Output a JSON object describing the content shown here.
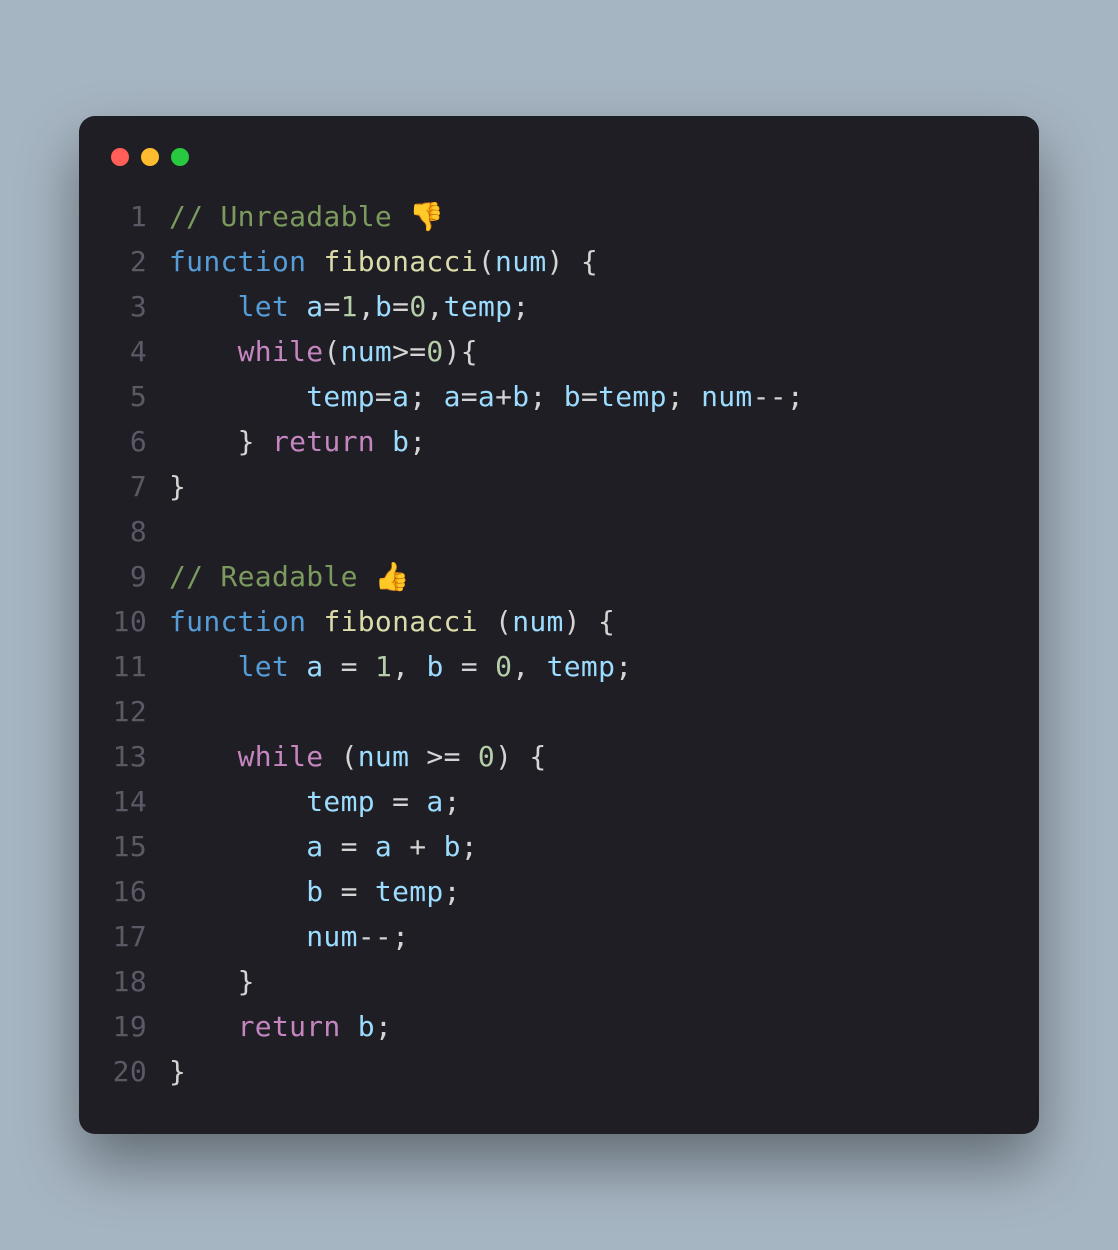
{
  "window": {
    "traffic_lights": [
      "close",
      "minimize",
      "maximize"
    ]
  },
  "code": {
    "lines": [
      {
        "num": "1",
        "tokens": [
          {
            "t": "// Unreadable 👎",
            "c": "comment"
          }
        ]
      },
      {
        "num": "2",
        "tokens": [
          {
            "t": "function",
            "c": "keyword2"
          },
          {
            "t": " ",
            "c": "default"
          },
          {
            "t": "fibonacci",
            "c": "function"
          },
          {
            "t": "(",
            "c": "punct"
          },
          {
            "t": "num",
            "c": "variable"
          },
          {
            "t": ") {",
            "c": "punct"
          }
        ]
      },
      {
        "num": "3",
        "tokens": [
          {
            "t": "    ",
            "c": "default"
          },
          {
            "t": "let",
            "c": "keyword2"
          },
          {
            "t": " ",
            "c": "default"
          },
          {
            "t": "a",
            "c": "variable"
          },
          {
            "t": "=",
            "c": "operator"
          },
          {
            "t": "1",
            "c": "number"
          },
          {
            "t": ",",
            "c": "punct"
          },
          {
            "t": "b",
            "c": "variable"
          },
          {
            "t": "=",
            "c": "operator"
          },
          {
            "t": "0",
            "c": "number"
          },
          {
            "t": ",",
            "c": "punct"
          },
          {
            "t": "temp",
            "c": "variable"
          },
          {
            "t": ";",
            "c": "punct"
          }
        ]
      },
      {
        "num": "4",
        "tokens": [
          {
            "t": "    ",
            "c": "default"
          },
          {
            "t": "while",
            "c": "keyword"
          },
          {
            "t": "(",
            "c": "punct"
          },
          {
            "t": "num",
            "c": "variable"
          },
          {
            "t": ">=",
            "c": "operator"
          },
          {
            "t": "0",
            "c": "number"
          },
          {
            "t": "){",
            "c": "punct"
          }
        ]
      },
      {
        "num": "5",
        "tokens": [
          {
            "t": "        ",
            "c": "default"
          },
          {
            "t": "temp",
            "c": "variable"
          },
          {
            "t": "=",
            "c": "operator"
          },
          {
            "t": "a",
            "c": "variable"
          },
          {
            "t": "; ",
            "c": "punct"
          },
          {
            "t": "a",
            "c": "variable"
          },
          {
            "t": "=",
            "c": "operator"
          },
          {
            "t": "a",
            "c": "variable"
          },
          {
            "t": "+",
            "c": "operator"
          },
          {
            "t": "b",
            "c": "variable"
          },
          {
            "t": "; ",
            "c": "punct"
          },
          {
            "t": "b",
            "c": "variable"
          },
          {
            "t": "=",
            "c": "operator"
          },
          {
            "t": "temp",
            "c": "variable"
          },
          {
            "t": "; ",
            "c": "punct"
          },
          {
            "t": "num",
            "c": "variable"
          },
          {
            "t": "--;",
            "c": "operator"
          }
        ]
      },
      {
        "num": "6",
        "tokens": [
          {
            "t": "    } ",
            "c": "punct"
          },
          {
            "t": "return",
            "c": "keyword"
          },
          {
            "t": " ",
            "c": "default"
          },
          {
            "t": "b",
            "c": "variable"
          },
          {
            "t": ";",
            "c": "punct"
          }
        ]
      },
      {
        "num": "7",
        "tokens": [
          {
            "t": "}",
            "c": "punct"
          }
        ]
      },
      {
        "num": "8",
        "tokens": []
      },
      {
        "num": "9",
        "tokens": [
          {
            "t": "// Readable 👍",
            "c": "comment"
          }
        ]
      },
      {
        "num": "10",
        "tokens": [
          {
            "t": "function",
            "c": "keyword2"
          },
          {
            "t": " ",
            "c": "default"
          },
          {
            "t": "fibonacci",
            "c": "function"
          },
          {
            "t": " (",
            "c": "punct"
          },
          {
            "t": "num",
            "c": "variable"
          },
          {
            "t": ") {",
            "c": "punct"
          }
        ]
      },
      {
        "num": "11",
        "tokens": [
          {
            "t": "    ",
            "c": "default"
          },
          {
            "t": "let",
            "c": "keyword2"
          },
          {
            "t": " ",
            "c": "default"
          },
          {
            "t": "a",
            "c": "variable"
          },
          {
            "t": " = ",
            "c": "operator"
          },
          {
            "t": "1",
            "c": "number"
          },
          {
            "t": ", ",
            "c": "punct"
          },
          {
            "t": "b",
            "c": "variable"
          },
          {
            "t": " = ",
            "c": "operator"
          },
          {
            "t": "0",
            "c": "number"
          },
          {
            "t": ", ",
            "c": "punct"
          },
          {
            "t": "temp",
            "c": "variable"
          },
          {
            "t": ";",
            "c": "punct"
          }
        ]
      },
      {
        "num": "12",
        "tokens": []
      },
      {
        "num": "13",
        "tokens": [
          {
            "t": "    ",
            "c": "default"
          },
          {
            "t": "while",
            "c": "keyword"
          },
          {
            "t": " (",
            "c": "punct"
          },
          {
            "t": "num",
            "c": "variable"
          },
          {
            "t": " >= ",
            "c": "operator"
          },
          {
            "t": "0",
            "c": "number"
          },
          {
            "t": ") {",
            "c": "punct"
          }
        ]
      },
      {
        "num": "14",
        "tokens": [
          {
            "t": "        ",
            "c": "default"
          },
          {
            "t": "temp",
            "c": "variable"
          },
          {
            "t": " = ",
            "c": "operator"
          },
          {
            "t": "a",
            "c": "variable"
          },
          {
            "t": ";",
            "c": "punct"
          }
        ]
      },
      {
        "num": "15",
        "tokens": [
          {
            "t": "        ",
            "c": "default"
          },
          {
            "t": "a",
            "c": "variable"
          },
          {
            "t": " = ",
            "c": "operator"
          },
          {
            "t": "a",
            "c": "variable"
          },
          {
            "t": " + ",
            "c": "operator"
          },
          {
            "t": "b",
            "c": "variable"
          },
          {
            "t": ";",
            "c": "punct"
          }
        ]
      },
      {
        "num": "16",
        "tokens": [
          {
            "t": "        ",
            "c": "default"
          },
          {
            "t": "b",
            "c": "variable"
          },
          {
            "t": " = ",
            "c": "operator"
          },
          {
            "t": "temp",
            "c": "variable"
          },
          {
            "t": ";",
            "c": "punct"
          }
        ]
      },
      {
        "num": "17",
        "tokens": [
          {
            "t": "        ",
            "c": "default"
          },
          {
            "t": "num",
            "c": "variable"
          },
          {
            "t": "--;",
            "c": "operator"
          }
        ]
      },
      {
        "num": "18",
        "tokens": [
          {
            "t": "    }",
            "c": "punct"
          }
        ]
      },
      {
        "num": "19",
        "tokens": [
          {
            "t": "    ",
            "c": "default"
          },
          {
            "t": "return",
            "c": "keyword"
          },
          {
            "t": " ",
            "c": "default"
          },
          {
            "t": "b",
            "c": "variable"
          },
          {
            "t": ";",
            "c": "punct"
          }
        ]
      },
      {
        "num": "20",
        "tokens": [
          {
            "t": "}",
            "c": "punct"
          }
        ]
      }
    ]
  }
}
